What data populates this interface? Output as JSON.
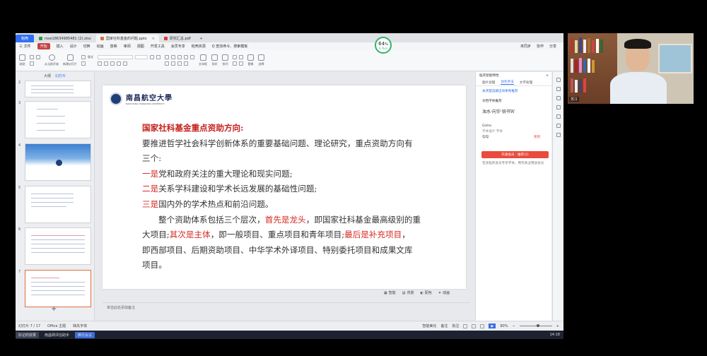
{
  "titlebar": {
    "home": "稻壳",
    "tabs": [
      {
        "label": "rose18634995481 (2).xlsx",
        "color": "#1f9d55"
      },
      {
        "label": "国家社科基金的问题.pptx",
        "color": "#e0703e"
      },
      {
        "label": "研究汇总.pdf",
        "color": "#d63c3c"
      }
    ],
    "new_tab": "+"
  },
  "menubar": {
    "items": [
      "三 文件",
      "开始",
      "插入",
      "设计",
      "切换",
      "动画",
      "放映",
      "审阅",
      "视图",
      "开发工具",
      "会员专享",
      "稻壳资源",
      "Q 查找命令、搜索模板"
    ],
    "active_index": 1,
    "right": [
      "未同步",
      "协作",
      "分享"
    ]
  },
  "ribbon": {
    "groups": [
      "粘贴",
      "从当前开始",
      "新建幻灯片",
      "版式",
      "文本框",
      "形状",
      "排列",
      "替换",
      "选择"
    ]
  },
  "badge": {
    "value": "64",
    "unit": "%",
    "sub": "0.7k/s"
  },
  "leftpanel": {
    "tabs": [
      "大纲",
      "幻灯片"
    ],
    "thumb_numbers": [
      "2",
      "3",
      "4",
      "5",
      "6",
      "7"
    ],
    "add": "+"
  },
  "slide": {
    "logo_cn": "南昌航空大學",
    "logo_en": "NANCHANG HANGKONG UNIVERSITY",
    "heading": "国家社科基金重点资助方向:",
    "intro": "要推进哲学社会科学创新体系的重要基础问题、理论研究，重点资助方向有",
    "intro2": "三个:",
    "items": [
      {
        "prefix": "一是",
        "text": "党和政府关注的重大理论和现实问题;"
      },
      {
        "prefix": "二是",
        "text": "关系学科建设和学术长远发展的基础性问题;"
      },
      {
        "prefix": "三是",
        "text": "国内外的学术热点和前沿问题。"
      }
    ],
    "para_a": "整个资助体系包括三个层次，",
    "para_b": "首先是龙头",
    "para_c": "，即国家社科基金最高级别的重",
    "para_d": "大项目;",
    "para_e": "其次是主体",
    "para_f": "，即一般项目、重点项目和青年项目;",
    "para_g": "最后是补充项目",
    "para_h": "，",
    "para_i": "即西部项目、后期资助项目、中华学术外译项目、特别委托项目和成果文库",
    "para_j": "项目。"
  },
  "slidetools": [
    "智能",
    "背景",
    "配色",
    "动画"
  ],
  "notes": "单击此处添加备注",
  "rightpane": {
    "title": "稻壳智能特性",
    "tabs": [
      "图片处理",
      "创作手法",
      "文字处理"
    ],
    "link": "关闭首选输出效果和推荐",
    "section": "文档字体推荐",
    "font1": "浊水·向宇·锐书W",
    "font2": "Gisha",
    "font2_note": "字体设计·字体",
    "font3": "勾勾",
    "font3_action": "更新",
    "button": "开通会员 · 推荐(2)",
    "note": "包含稻壳会员专享字体，用作商业用途会员"
  },
  "statusbar": {
    "slide_count": "幻灯片 7 / 17",
    "theme": "Office 主题",
    "missing_font": "缺失字体",
    "smart": "智能美化",
    "notes_btn": "备注",
    "comment": "批注",
    "zoom": "80%"
  },
  "taskbar": {
    "item1": "好记的效果",
    "item2": "南昌网评估助手",
    "item3": "腾讯会议",
    "time": "14:18"
  },
  "webcam": {
    "label": "苏江"
  }
}
